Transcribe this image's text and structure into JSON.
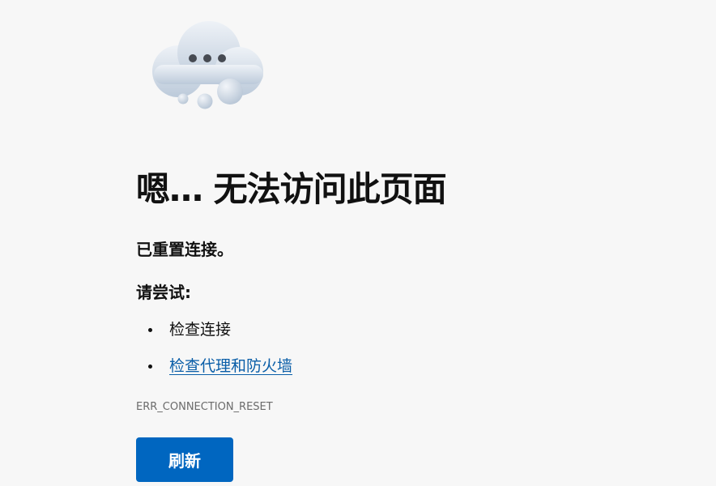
{
  "error_page": {
    "illustration": "cloud-ellipsis-icon",
    "title": "嗯… 无法访问此页面",
    "subtitle": "已重置连接。",
    "try_label": "请尝试:",
    "suggestions": [
      {
        "text": "检查连接",
        "is_link": false
      },
      {
        "text": "检查代理和防火墙",
        "is_link": true
      }
    ],
    "error_code": "ERR_CONNECTION_RESET",
    "refresh_button": "刷新"
  },
  "colors": {
    "background": "#f7f7f7",
    "button": "#0066c0",
    "link": "#0a5ea8",
    "error_code_text": "#6b6b6b"
  }
}
